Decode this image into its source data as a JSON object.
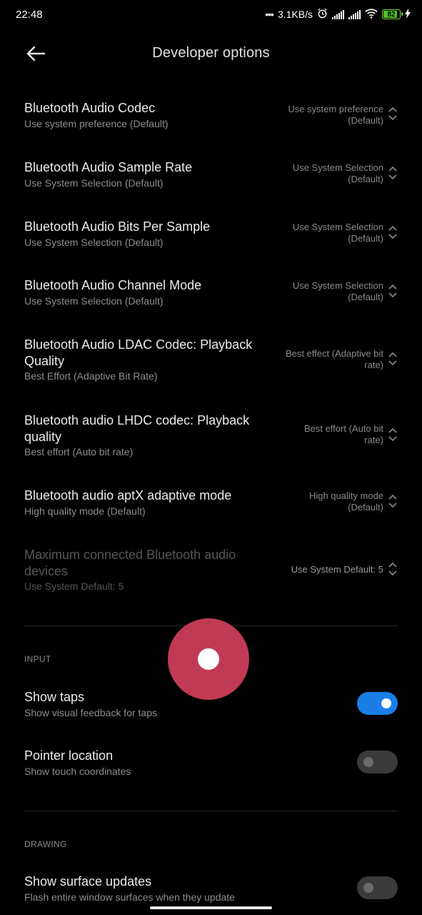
{
  "status_bar": {
    "time": "22:48",
    "net_speed": "3.1KB/s",
    "battery_level": "82",
    "icons": [
      "more-dots-icon",
      "alarm-icon",
      "signal-icon",
      "signal-icon",
      "wifi-icon",
      "battery-icon",
      "charging-icon"
    ]
  },
  "header": {
    "title": "Developer options",
    "back_icon": "back-arrow-icon"
  },
  "bluetooth": [
    {
      "title": "Bluetooth Audio Codec",
      "subtitle": "Use system preference (Default)",
      "value_line1": "Use system preference",
      "value_line2": "(Default)"
    },
    {
      "title": "Bluetooth Audio Sample Rate",
      "subtitle": "Use System Selection (Default)",
      "value_line1": "Use System Selection",
      "value_line2": "(Default)"
    },
    {
      "title": "Bluetooth Audio Bits Per Sample",
      "subtitle": "Use System Selection (Default)",
      "value_line1": "Use System Selection",
      "value_line2": "(Default)"
    },
    {
      "title": "Bluetooth Audio Channel Mode",
      "subtitle": "Use System Selection (Default)",
      "value_line1": "Use System Selection",
      "value_line2": "(Default)"
    },
    {
      "title_line1": "Bluetooth Audio LDAC Codec: Playback",
      "title_line2": "Quality",
      "subtitle": "Best Effort (Adaptive Bit Rate)",
      "value_line1": "Best effect (Adaptive bit",
      "value_line2": "rate)"
    },
    {
      "title_line1": "Bluetooth audio LHDC codec: Playback",
      "title_line2": "quality",
      "subtitle": "Best effort (Auto bit rate)",
      "value_line1": "Best effort (Auto bit",
      "value_line2": "rate)"
    },
    {
      "title": "Bluetooth audio aptX adaptive mode",
      "subtitle": "High quality mode (Default)",
      "value_line1": "High quality mode",
      "value_line2": "(Default)"
    },
    {
      "title_line1": "Maximum connected Bluetooth audio",
      "title_line2": "devices",
      "subtitle": "Use System Default: 5",
      "value": "Use System Default: 5",
      "disabled": true
    }
  ],
  "input_section": {
    "header": "INPUT",
    "show_taps": {
      "title": "Show taps",
      "subtitle": "Show visual feedback for taps",
      "enabled": true
    },
    "pointer_location": {
      "title": "Pointer location",
      "subtitle": "Show touch coordinates",
      "enabled": false
    }
  },
  "drawing_section": {
    "header": "DRAWING",
    "show_surface_updates": {
      "title": "Show surface updates",
      "subtitle": "Flash entire window surfaces when they update",
      "enabled": false
    }
  },
  "colors": {
    "accent": "#1a7ee6",
    "tap_indicator": "#c13a55",
    "background": "#000000"
  }
}
